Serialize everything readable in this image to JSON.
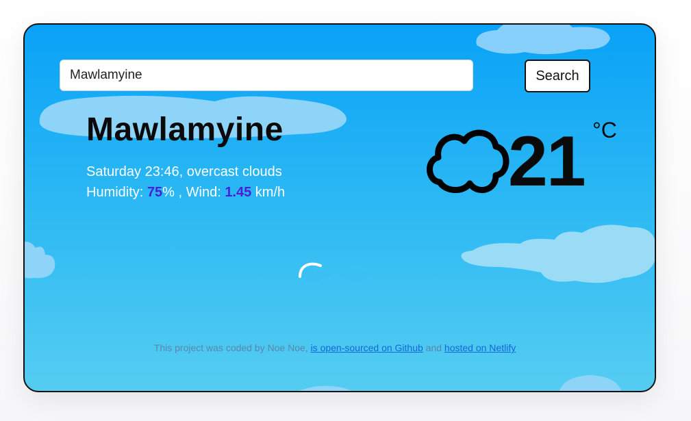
{
  "search": {
    "value": "Mawlamyine",
    "button_label": "Search"
  },
  "weather": {
    "city": "Mawlamyine",
    "day_time": "Saturday 23:46",
    "description": "overcast clouds",
    "humidity_label": "Humidity: ",
    "humidity_value": "75",
    "humidity_unit": "%",
    "wind_label": " , Wind: ",
    "wind_value": "1.45",
    "wind_unit": " km/h",
    "temperature": "21",
    "temperature_unit": "°C",
    "icon": "cloud-icon"
  },
  "footer": {
    "text_prefix": "This project was coded by Noe Noe, ",
    "github_link": "is open-sourced on Github",
    "text_middle": " and ",
    "netlify_link": "hosted on Netlify"
  },
  "colors": {
    "sky_top": "#0aa2f7",
    "sky_bottom": "#55cdf2",
    "highlight": "#4a1ed8",
    "link": "#1466d6"
  }
}
